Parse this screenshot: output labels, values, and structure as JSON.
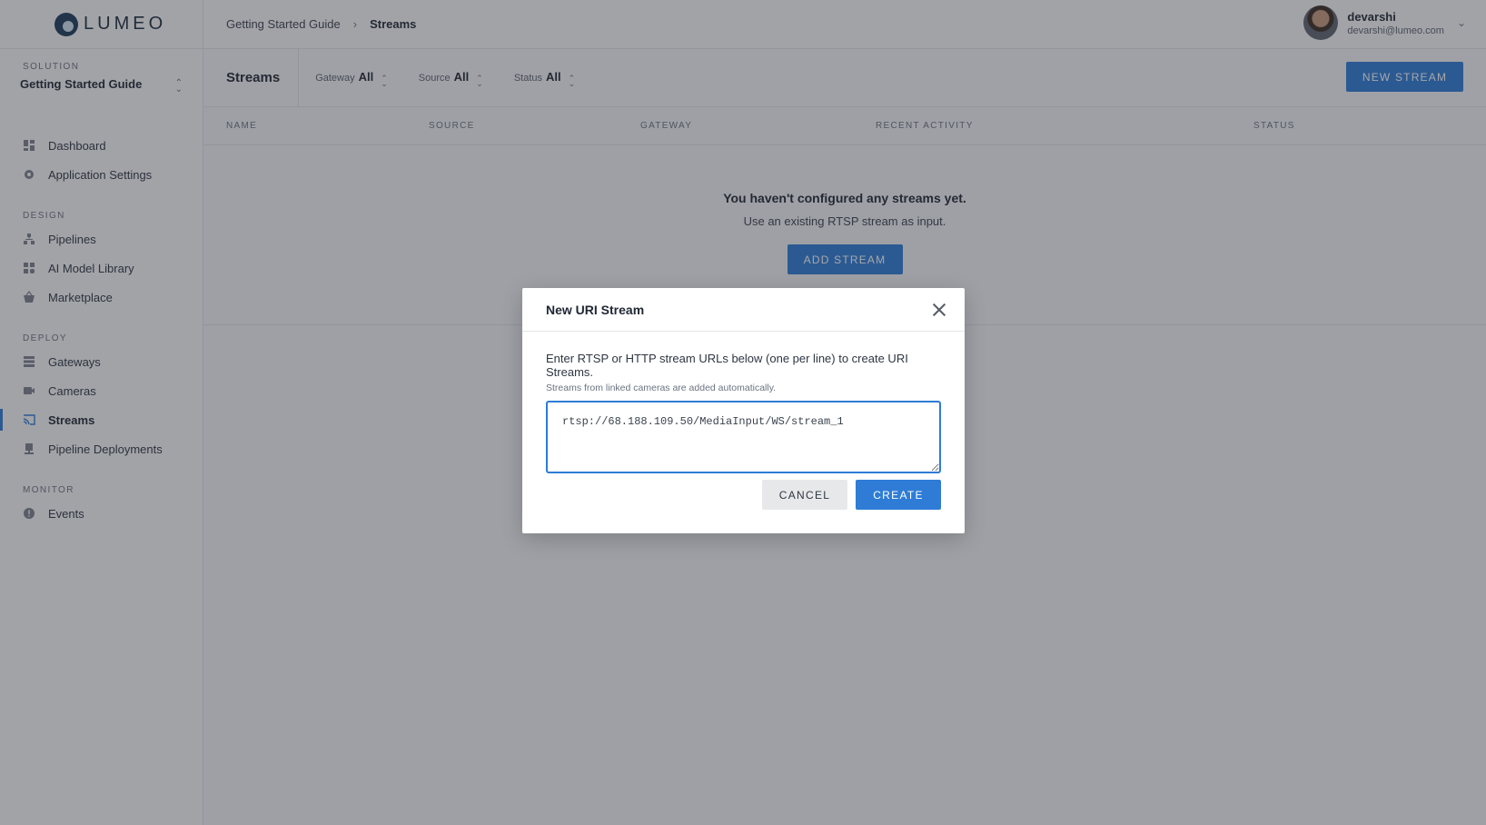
{
  "logo": {
    "text": "LUMEO"
  },
  "breadcrumb": {
    "parent": "Getting Started Guide",
    "separator": "›",
    "current": "Streams"
  },
  "user": {
    "name": "devarshi",
    "email": "devarshi@lumeo.com"
  },
  "solution": {
    "label": "SOLUTION",
    "value": "Getting Started Guide"
  },
  "sidebar": {
    "items_top": [
      {
        "label": "Dashboard",
        "icon": "dashboard-icon"
      },
      {
        "label": "Application Settings",
        "icon": "gear-icon"
      }
    ],
    "design_label": "DESIGN",
    "design": [
      {
        "label": "Pipelines",
        "icon": "pipelines-icon"
      },
      {
        "label": "AI Model Library",
        "icon": "model-library-icon"
      },
      {
        "label": "Marketplace",
        "icon": "basket-icon"
      }
    ],
    "deploy_label": "DEPLOY",
    "deploy": [
      {
        "label": "Gateways",
        "icon": "server-icon"
      },
      {
        "label": "Cameras",
        "icon": "camera-icon"
      },
      {
        "label": "Streams",
        "icon": "cast-icon",
        "active": true
      },
      {
        "label": "Pipeline Deployments",
        "icon": "deployment-icon"
      }
    ],
    "monitor_label": "MONITOR",
    "monitor": [
      {
        "label": "Events",
        "icon": "alert-icon"
      }
    ]
  },
  "toolbar": {
    "title": "Streams",
    "filters": [
      {
        "label": "Gateway",
        "value": "All"
      },
      {
        "label": "Source",
        "value": "All"
      },
      {
        "label": "Status",
        "value": "All"
      }
    ],
    "new_stream_label": "NEW STREAM"
  },
  "table": {
    "columns": [
      "NAME",
      "SOURCE",
      "GATEWAY",
      "RECENT ACTIVITY",
      "STATUS"
    ]
  },
  "empty": {
    "title": "You haven't configured any streams yet.",
    "subtitle": "Use an existing RTSP stream as input.",
    "button": "ADD STREAM"
  },
  "modal": {
    "title": "New URI Stream",
    "description": "Enter RTSP or HTTP stream URLs below (one per line) to create URI Streams.",
    "hint": "Streams from linked cameras are added automatically.",
    "uri_value": "rtsp://68.188.109.50/MediaInput/WS/stream_1",
    "cancel_label": "CANCEL",
    "create_label": "CREATE"
  },
  "colors": {
    "accent": "#2e7cd6",
    "overlay": "rgba(40,44,52,0.42)"
  }
}
